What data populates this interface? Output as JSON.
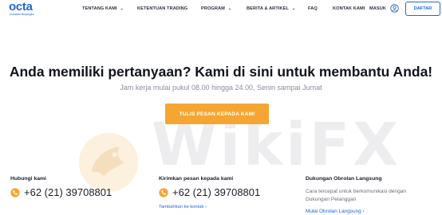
{
  "brand": {
    "name": "octa",
    "tagline": "Investasi Berjangka"
  },
  "nav": {
    "items": [
      {
        "label": "TENTANG KAMI",
        "has_dropdown": true
      },
      {
        "label": "KETENTUAN TRADING",
        "has_dropdown": false
      },
      {
        "label": "PROGRAM",
        "has_dropdown": true
      },
      {
        "label": "BERITA & ARTIKEL",
        "has_dropdown": true
      },
      {
        "label": "FAQ",
        "has_dropdown": false
      },
      {
        "label": "KONTAK KAMI",
        "has_dropdown": false
      },
      {
        "label": "MASUK",
        "has_dropdown": false
      }
    ],
    "user_icon": "user-circle-icon",
    "signup_label": "DAFTAR"
  },
  "hero": {
    "headline": "Anda memiliki pertanyaan? Kami di sini untuk membantu Anda!",
    "subline": "Jam kerja mulai pukul 08.00 hingga 24.00, Senin sampai Jumat",
    "cta_label": "TULIS PESAN KEPADA KAMI"
  },
  "watermark": {
    "text": "WikiFX"
  },
  "contacts": {
    "call": {
      "title": "Hubungi kami",
      "phone": "+62 (21) 39708801",
      "icon": "phone-icon"
    },
    "sms": {
      "title": "Kirimkan pesan kepada kami",
      "phone": "+62 (21) 39708801",
      "icon": "phone-icon",
      "link": "Tambahkan ke kontak"
    },
    "chat": {
      "title": "Dukungan Obrolan Langsung",
      "description": "Cara tercepat untuk berkomunikasi dengan Dukungan Pelanggan",
      "link": "Mulai Obrolan Langsung"
    }
  },
  "colors": {
    "brand_blue": "#2467d6",
    "cta_orange": "#f5a632",
    "text_dark": "#1c1f2b",
    "text_muted": "#8a8f9b"
  }
}
